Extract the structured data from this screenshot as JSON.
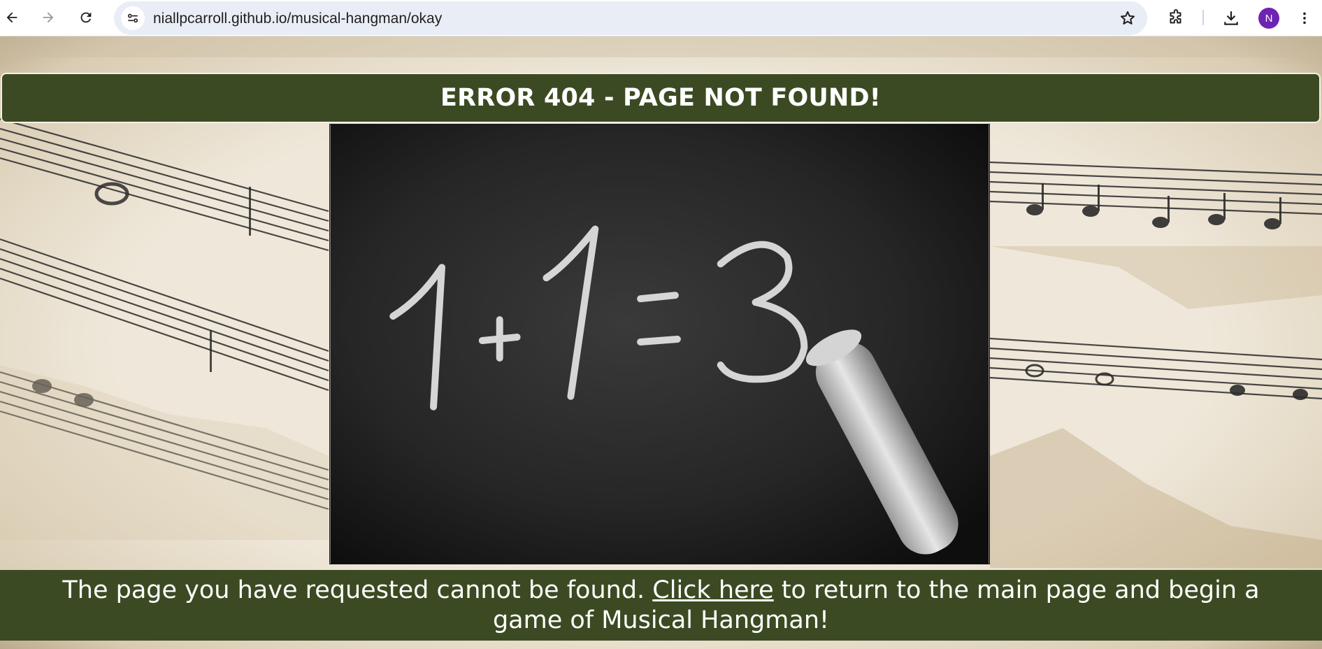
{
  "browser": {
    "url": "niallpcarroll.github.io/musical-hangman/okay",
    "avatar_letter": "N",
    "avatar_color": "#6e24b3"
  },
  "page": {
    "heading": "ERROR 404 - PAGE NOT FOUND!",
    "message_before": "The page you have requested cannot be found. ",
    "link_text": "Click here",
    "message_after": " to return to the main page and begin a game of Musical Hangman!",
    "image_chalk_text": "1+1=3",
    "accent_color": "#3b4a22"
  }
}
